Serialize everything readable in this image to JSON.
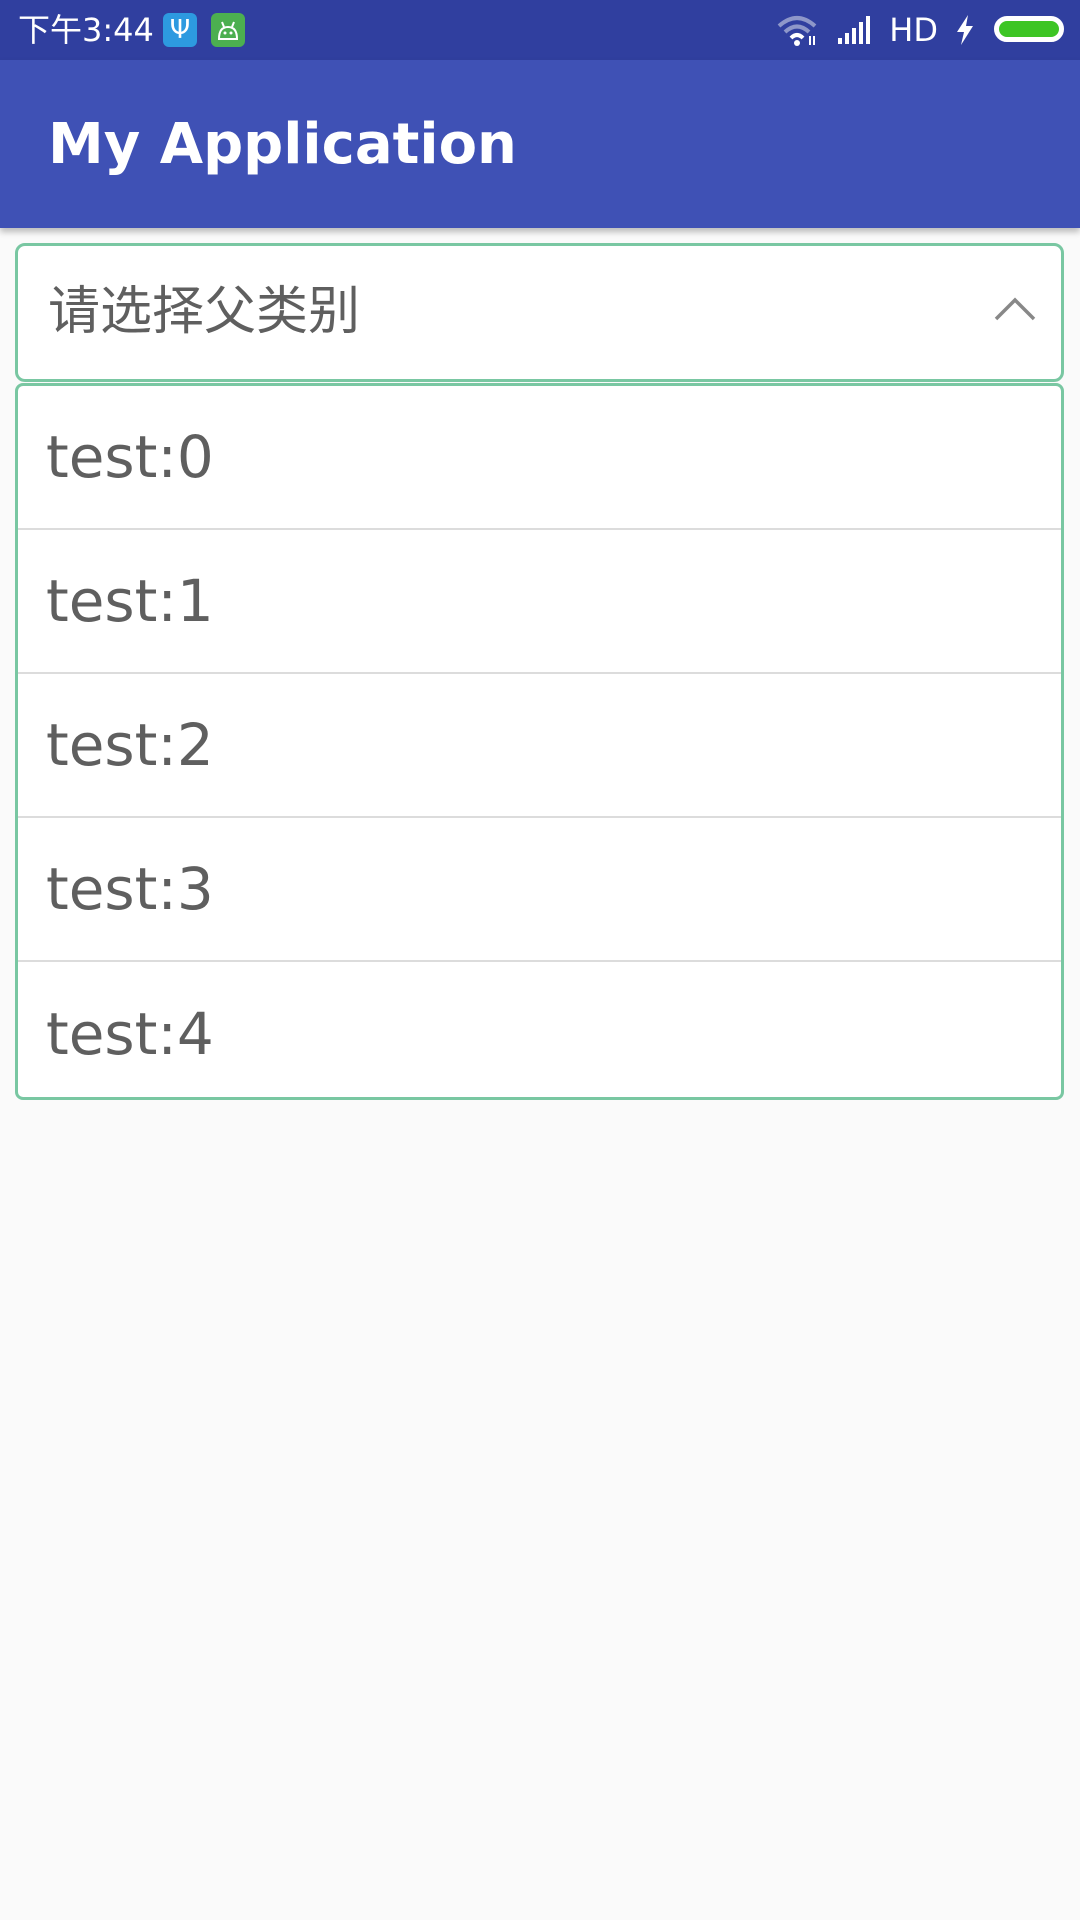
{
  "status_bar": {
    "time": "下午3:44",
    "network_label": "HD",
    "icons": [
      "usb-icon",
      "android-debug-icon",
      "wifi-icon",
      "signal-icon",
      "charging-icon",
      "battery-icon"
    ],
    "battery_color": "#3dc524"
  },
  "app_bar": {
    "title": "My Application",
    "color": "#3f51b5"
  },
  "spinner": {
    "placeholder": "请选择父类别",
    "expanded_icon": "chevron-up-icon",
    "border_color": "#79c7a2"
  },
  "dropdown": {
    "items": [
      {
        "label": "test:0"
      },
      {
        "label": "test:1"
      },
      {
        "label": "test:2"
      },
      {
        "label": "test:3"
      },
      {
        "label": "test:4"
      }
    ]
  }
}
